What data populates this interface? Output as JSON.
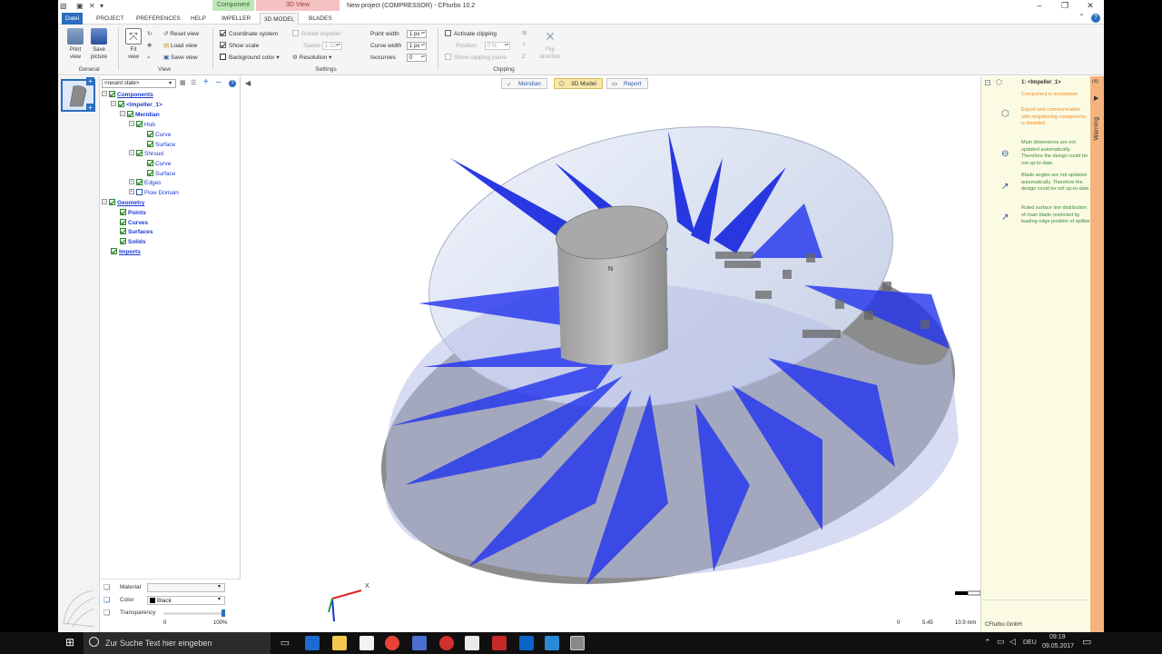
{
  "window": {
    "title": "New project (COMPRESSOR) - CFturbo 10.2",
    "context_tab_component": "Component",
    "context_tab_3dview": "3D View"
  },
  "menu": {
    "tabs": [
      "Datei",
      "PROJECT",
      "PREFERENCES",
      "HELP",
      "IMPELLER",
      "3D MODEL",
      "BLADES"
    ]
  },
  "ribbon": {
    "general": {
      "label": "General",
      "print_view": [
        "Print",
        "view"
      ],
      "save_picture": [
        "Save",
        "picture"
      ]
    },
    "view": {
      "label": "View",
      "fit_view": [
        "Fit",
        "view"
      ],
      "reset_view": "Reset view",
      "load_view": "Load view",
      "save_view": "Save view"
    },
    "settings": {
      "label": "Settings",
      "coordinate_system": "Coordinate system",
      "show_scale": "Show scale",
      "background_color": "Background color",
      "rotate_impeller": "Rotate impeller",
      "speed_label": "Speed",
      "speed_value": "1 /10",
      "resolution": "Resolution",
      "point_width_label": "Point width",
      "point_width_value": "1 px",
      "curve_width_label": "Curve width",
      "curve_width_value": "1 px",
      "isocurves_label": "Isocurves",
      "isocurves_value": "0"
    },
    "clipping": {
      "label": "Clipping",
      "activate_clipping": "Activate clipping",
      "position_label": "Position",
      "position_value": "0 %",
      "show_clipping_plane": "Show clipping plane",
      "flip_direction": [
        "Flip",
        "direction"
      ]
    }
  },
  "tree": {
    "state_select": "<recent state>",
    "nodes": {
      "components": "Components",
      "impeller": "<Impeller_1>",
      "meridian": "Meridian",
      "hub": "Hub",
      "hub_curve": "Curve",
      "hub_surface": "Surface",
      "shroud": "Shroud",
      "shroud_curve": "Curve",
      "shroud_surface": "Surface",
      "edges": "Edges",
      "flow_domain": "Flow Domain",
      "geometry": "Geometry",
      "points": "Points",
      "curves": "Curves",
      "surfaces": "Surfaces",
      "solids": "Solids",
      "imports": "Imports"
    }
  },
  "properties": {
    "material_label": "Material",
    "material_value": "",
    "color_label": "Color",
    "color_value": "Black",
    "transparency_label": "Transparency",
    "transparency_min": "0",
    "transparency_max": "100%",
    "transparency_level": 1.0
  },
  "viewport": {
    "tabs": [
      "Meridian",
      "3D Model",
      "Report"
    ],
    "active_tab": "3D Model",
    "scale_labels": [
      "0",
      "5.45",
      "10.9 mm"
    ],
    "axis_x": "X",
    "axis_label_n": "N"
  },
  "warnings": {
    "header": "1: <Impeller_1>",
    "count": "(4)",
    "side_label": "Warning",
    "incomplete": "Component is incomplete",
    "items": [
      "Export and communication with neighboring components is disabled",
      "Main dimensions are not updated automatically. Therefore the design could be not up-to-date.",
      "Blade angles are not updated automatically. Therefore the design could be not up-to-date.",
      "Ruled surface line distribution of main blade restricted by leading edge position of splitter"
    ],
    "footer": "CFturbo GmbH"
  },
  "taskbar": {
    "search_placeholder": "Zur Suche Text hier eingeben",
    "language": "DEU",
    "time": "09:19",
    "date": "09.05.2017"
  },
  "colors": {
    "accent": "#2a6dbf",
    "blade_blue": "#1f2fe0",
    "warning_orange": "#f4b27c",
    "warning_text": "#f08a20",
    "info_text": "#3a8a3a",
    "tree_blue": "#1a3ad0"
  }
}
